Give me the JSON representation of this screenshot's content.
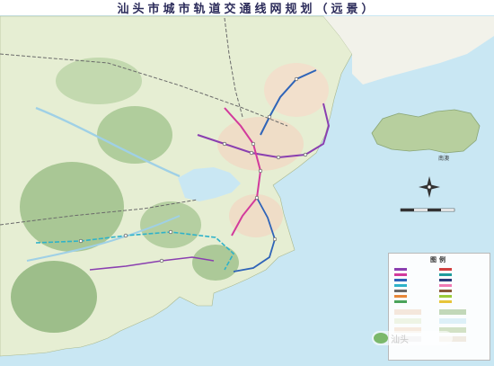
{
  "title": "汕头市城市轨道交通线网规划（远景）",
  "legend": {
    "title": "图例"
  },
  "island_label": "南澳",
  "watermark_text": "汕头",
  "colors": {
    "sea": "#c9e7f3",
    "land": "#e6eed3",
    "forest": "#9dbf8a",
    "urban": "#f0d9c4",
    "line_purple": "#8a3fb0",
    "line_magenta": "#d23a9c",
    "line_blue": "#2f64b8",
    "line_cyan": "#2fb2c9",
    "rail_grey": "#6a6a6a"
  },
  "icons": [
    "compass-rose-icon",
    "scale-bar-icon",
    "wechat-logo-icon"
  ]
}
